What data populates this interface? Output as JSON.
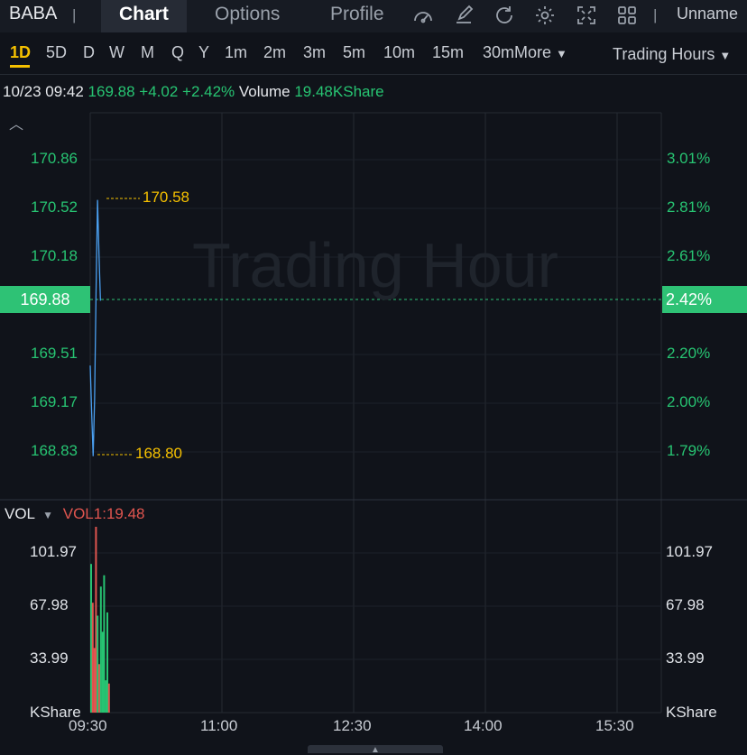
{
  "header": {
    "ticker": "BABA",
    "separator": "|",
    "tabs": [
      "Chart",
      "Options",
      "Profile"
    ],
    "active_tab": "Chart",
    "user": "Unname",
    "icons": [
      "gauge-icon",
      "draw-icon",
      "refresh-icon",
      "gear-icon",
      "fullscreen-icon",
      "grid-icon"
    ]
  },
  "periods": {
    "items": [
      "1D",
      "5D",
      "D",
      "W",
      "M",
      "Q",
      "Y",
      "1m",
      "2m",
      "3m",
      "5m",
      "10m",
      "15m",
      "30m"
    ],
    "active": "1D",
    "more": "More",
    "session": "Trading Hours"
  },
  "quote": {
    "datetime": "10/23 09:42",
    "price": "169.88",
    "change": "+4.02",
    "change_pct": "+2.42%",
    "volume_label": "Volume",
    "volume": "19.48KShare"
  },
  "watermark": "Trading Hour",
  "colors": {
    "up": "#27c472",
    "down": "#e0554f",
    "line": "#4a9ff0",
    "highlight": "#f5c000"
  },
  "chart_data": {
    "type": "line",
    "y_left_ticks": [
      "170.86",
      "170.52",
      "170.18",
      "169.51",
      "169.17",
      "168.83"
    ],
    "y_right_ticks": [
      "3.01%",
      "2.81%",
      "2.61%",
      "2.20%",
      "2.00%",
      "1.79%"
    ],
    "current_price": "169.88",
    "current_pct": "2.42%",
    "high_label": "170.58",
    "low_label": "168.80",
    "x_ticks": [
      "09:30",
      "11:00",
      "12:30",
      "14:00",
      "15:30"
    ],
    "ylim": [
      168.6,
      171.1
    ],
    "price_series": [
      {
        "t": "09:30",
        "v": 169.43
      },
      {
        "t": "09:31",
        "v": 169.1
      },
      {
        "t": "09:32",
        "v": 168.8
      },
      {
        "t": "09:33",
        "v": 169.2
      },
      {
        "t": "09:34",
        "v": 169.95
      },
      {
        "t": "09:35",
        "v": 170.58
      },
      {
        "t": "09:36",
        "v": 170.2
      },
      {
        "t": "09:37",
        "v": 169.88
      }
    ],
    "volume": {
      "header": "VOL",
      "indicator": "VOL1:19.48",
      "ticks": [
        "101.97",
        "67.98",
        "33.99"
      ],
      "unit": "KShare",
      "ylim": [
        0,
        115
      ],
      "bars": [
        {
          "t": "09:30",
          "v": 92,
          "dir": "up"
        },
        {
          "t": "09:31",
          "v": 68,
          "dir": "down"
        },
        {
          "t": "09:31",
          "v": 40,
          "dir": "down"
        },
        {
          "t": "09:32",
          "v": 115,
          "dir": "down"
        },
        {
          "t": "09:32",
          "v": 60,
          "dir": "up"
        },
        {
          "t": "09:33",
          "v": 30,
          "dir": "down"
        },
        {
          "t": "09:33",
          "v": 78,
          "dir": "up"
        },
        {
          "t": "09:34",
          "v": 50,
          "dir": "up"
        },
        {
          "t": "09:34",
          "v": 85,
          "dir": "up"
        },
        {
          "t": "09:35",
          "v": 20,
          "dir": "up"
        },
        {
          "t": "09:35",
          "v": 62,
          "dir": "up"
        },
        {
          "t": "09:36",
          "v": 18,
          "dir": "down"
        }
      ]
    }
  }
}
